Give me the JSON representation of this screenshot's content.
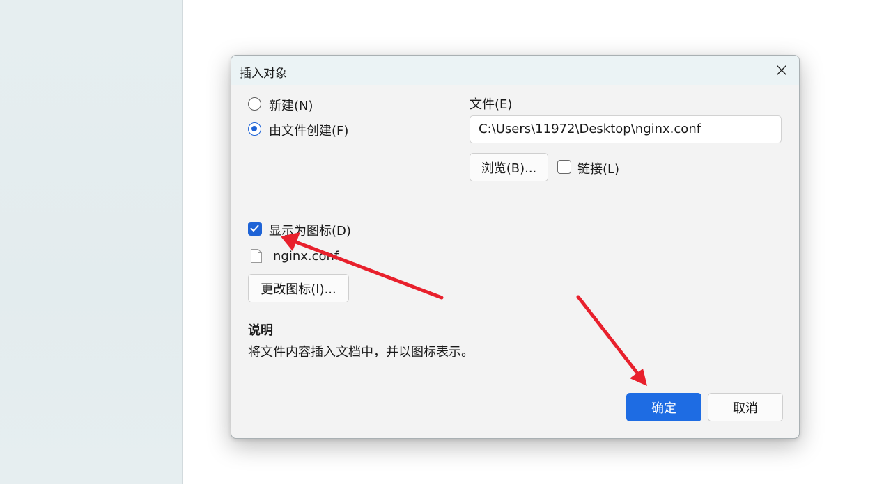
{
  "dialog": {
    "title": "插入对象",
    "options": {
      "new_label": "新建(N)",
      "from_file_label": "由文件创建(F)"
    },
    "file": {
      "label": "文件(E)",
      "path": "C:\\Users\\11972\\Desktop\\nginx.conf",
      "browse_label": "浏览(B)...",
      "link_label": "链接(L)"
    },
    "display_as_icon": {
      "label": "显示为图标(D)",
      "checked": true,
      "icon_caption": "nginx.conf",
      "change_icon_label": "更改图标(I)..."
    },
    "description": {
      "heading": "说明",
      "text": "将文件内容插入文档中，并以图标表示。"
    },
    "buttons": {
      "ok_label": "确定",
      "cancel_label": "取消"
    }
  },
  "colors": {
    "accent": "#1e6ce3",
    "annotation_arrow": "#e8202c"
  },
  "icons": [
    "close-icon",
    "file-icon",
    "checkmark-icon"
  ]
}
